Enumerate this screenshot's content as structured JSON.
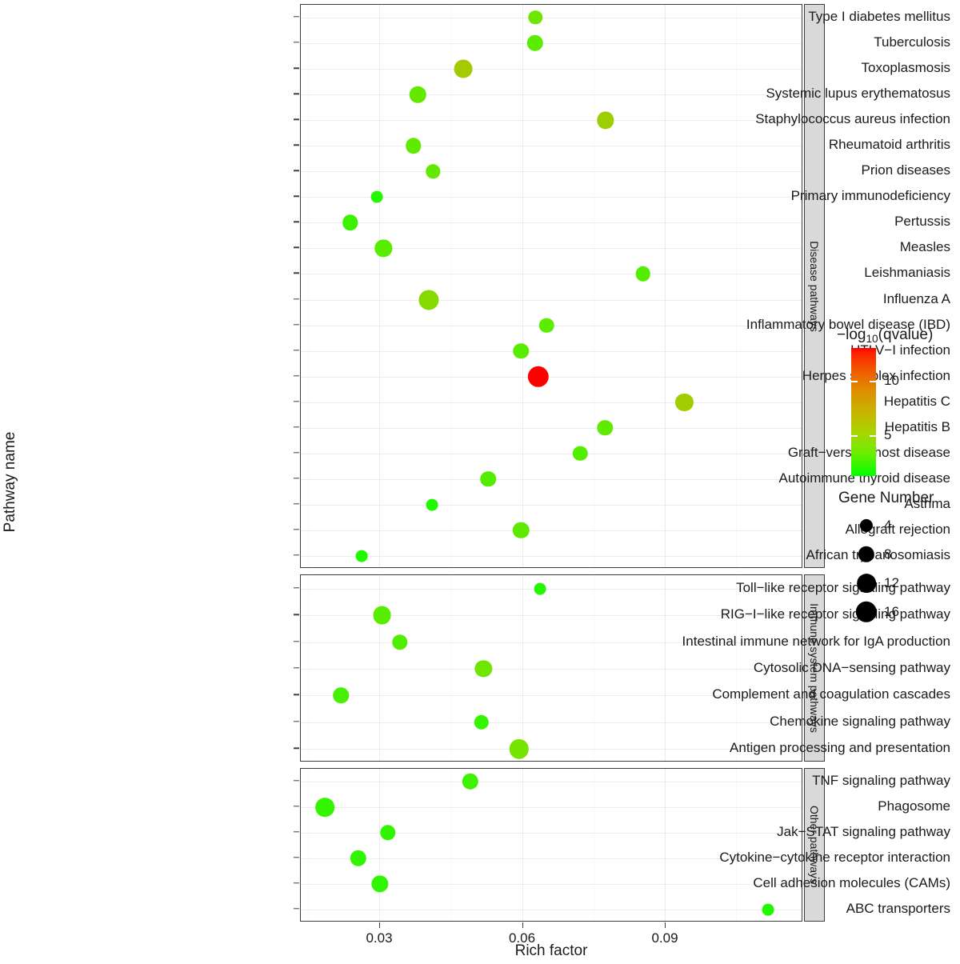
{
  "axes": {
    "y_title": "Pathway name",
    "x_title": "Rich factor",
    "x_ticks": [
      0.03,
      0.06,
      0.09
    ],
    "x_tick_labels": [
      "0.03",
      "0.06",
      "0.09"
    ],
    "x_range": [
      0.0125,
      0.1185
    ]
  },
  "legends": {
    "color": {
      "title_prefix": "−log",
      "title_sub": "10",
      "title_suffix": "(qvalue)",
      "title_full": "−log10(qvalue)",
      "ticks": [
        5,
        10
      ],
      "tick_labels": [
        "5",
        "10"
      ],
      "range": [
        1.3,
        13.0
      ],
      "low_color": "#00ff00",
      "mid_color": "#c8b400",
      "high_color": "#ff0000"
    },
    "size": {
      "title": "Gene Number",
      "breaks": [
        4,
        8,
        12,
        16
      ],
      "break_labels": [
        "4",
        "8",
        "12",
        "16"
      ]
    }
  },
  "chart_data": {
    "type": "scatter",
    "title": "",
    "xlabel": "Rich factor",
    "ylabel": "Pathway name",
    "xlim": [
      0.0125,
      0.1185
    ],
    "grid": true,
    "legend_position": "right",
    "facets": [
      {
        "label": "Disease pathways",
        "points": [
          {
            "name": "Type I diabetes mellitus",
            "rich": 0.0628,
            "gene_number": 5,
            "qvalue_log10": 3.0,
            "color": "#6ee600"
          },
          {
            "name": "Tuberculosis",
            "rich": 0.0627,
            "gene_number": 8,
            "qvalue_log10": 3.2,
            "color": "#5bed00"
          },
          {
            "name": "Toxoplasmosis",
            "rich": 0.0476,
            "gene_number": 11,
            "qvalue_log10": 5.2,
            "color": "#a4ca00"
          },
          {
            "name": "Systemic lupus erythematosus",
            "rich": 0.0381,
            "gene_number": 8,
            "qvalue_log10": 3.1,
            "color": "#63e900"
          },
          {
            "name": "Staphylococcus aureus infection",
            "rich": 0.0775,
            "gene_number": 9,
            "qvalue_log10": 4.8,
            "color": "#9dce00"
          },
          {
            "name": "Rheumatoid arthritis",
            "rich": 0.0372,
            "gene_number": 7,
            "qvalue_log10": 3.0,
            "color": "#5fea00"
          },
          {
            "name": "Prion diseases",
            "rich": 0.0413,
            "gene_number": 5,
            "qvalue_log10": 3.0,
            "color": "#62e900"
          },
          {
            "name": "Primary immunodeficiency",
            "rich": 0.0295,
            "gene_number": 3,
            "qvalue_log10": 2.2,
            "color": "#22f800"
          },
          {
            "name": "Pertussis",
            "rich": 0.0239,
            "gene_number": 7,
            "qvalue_log10": 2.6,
            "color": "#3bf300"
          },
          {
            "name": "Measles",
            "rich": 0.0309,
            "gene_number": 9,
            "qvalue_log10": 2.9,
            "color": "#57ec00"
          },
          {
            "name": "Leishmaniasis",
            "rich": 0.0854,
            "gene_number": 6,
            "qvalue_log10": 2.8,
            "color": "#52ed00"
          },
          {
            "name": "Influenza A",
            "rich": 0.0404,
            "gene_number": 14,
            "qvalue_log10": 4.0,
            "color": "#86da00"
          },
          {
            "name": "Inflammatory bowel disease (IBD)",
            "rich": 0.0652,
            "gene_number": 6,
            "qvalue_log10": 2.9,
            "color": "#5bec00"
          },
          {
            "name": "HTLV−I infection",
            "rich": 0.0598,
            "gene_number": 7,
            "qvalue_log10": 2.9,
            "color": "#58ec00"
          },
          {
            "name": "Herpes simplex infection",
            "rich": 0.0634,
            "gene_number": 16,
            "qvalue_log10": 13.0,
            "color": "#ff0000"
          },
          {
            "name": "Hepatitis C",
            "rich": 0.0941,
            "gene_number": 10,
            "qvalue_log10": 5.0,
            "color": "#a0cd00"
          },
          {
            "name": "Hepatitis B",
            "rich": 0.0774,
            "gene_number": 7,
            "qvalue_log10": 3.0,
            "color": "#5fea00"
          },
          {
            "name": "Graft−versus−host disease",
            "rich": 0.0722,
            "gene_number": 6,
            "qvalue_log10": 2.8,
            "color": "#51ee00"
          },
          {
            "name": "Autoimmune thyroid disease",
            "rich": 0.0529,
            "gene_number": 7,
            "qvalue_log10": 2.8,
            "color": "#52ed00"
          },
          {
            "name": "Asthma",
            "rich": 0.0411,
            "gene_number": 3,
            "qvalue_log10": 2.1,
            "color": "#1ef900"
          },
          {
            "name": "Allograft rejection",
            "rich": 0.0598,
            "gene_number": 8,
            "qvalue_log10": 3.0,
            "color": "#5eea00"
          },
          {
            "name": "African trypanosomiasis",
            "rich": 0.0263,
            "gene_number": 3,
            "qvalue_log10": 2.1,
            "color": "#20f800"
          }
        ]
      },
      {
        "label": "Immune system pathways",
        "points": [
          {
            "name": "Toll−like receptor signaling pathway",
            "rich": 0.0638,
            "gene_number": 3,
            "qvalue_log10": 2.2,
            "color": "#25f700"
          },
          {
            "name": "RIG−I−like receptor signaling pathway",
            "rich": 0.0306,
            "gene_number": 11,
            "qvalue_log10": 2.9,
            "color": "#57ec00"
          },
          {
            "name": "Intestinal immune network for IgA production",
            "rich": 0.0343,
            "gene_number": 7,
            "qvalue_log10": 2.8,
            "color": "#4fee00"
          },
          {
            "name": "Cytosolic DNA−sensing pathway",
            "rich": 0.0519,
            "gene_number": 9,
            "qvalue_log10": 3.3,
            "color": "#6fe600"
          },
          {
            "name": "Complement and coagulation cascades",
            "rich": 0.022,
            "gene_number": 7,
            "qvalue_log10": 2.7,
            "color": "#48ef00"
          },
          {
            "name": "Chemokine signaling pathway",
            "rich": 0.0515,
            "gene_number": 6,
            "qvalue_log10": 2.5,
            "color": "#33f500"
          },
          {
            "name": "Antigen processing and presentation",
            "rich": 0.0594,
            "gene_number": 13,
            "qvalue_log10": 3.4,
            "color": "#77e300"
          }
        ]
      },
      {
        "label": "Other pathways",
        "points": [
          {
            "name": "TNF signaling pathway",
            "rich": 0.0491,
            "gene_number": 8,
            "qvalue_log10": 2.6,
            "color": "#3ef200"
          },
          {
            "name": "Phagosome",
            "rich": 0.0186,
            "gene_number": 12,
            "qvalue_log10": 2.5,
            "color": "#33f500"
          },
          {
            "name": "Jak−STAT signaling pathway",
            "rich": 0.0318,
            "gene_number": 7,
            "qvalue_log10": 2.5,
            "color": "#31f500"
          },
          {
            "name": "Cytokine−cytokine receptor interaction",
            "rich": 0.0256,
            "gene_number": 8,
            "qvalue_log10": 2.5,
            "color": "#31f500"
          },
          {
            "name": "Cell adhesion molecules (CAMs)",
            "rich": 0.0302,
            "gene_number": 9,
            "qvalue_log10": 2.5,
            "color": "#30f600"
          },
          {
            "name": "ABC transporters",
            "rich": 0.1117,
            "gene_number": 3,
            "qvalue_log10": 2.1,
            "color": "#20f800"
          }
        ]
      }
    ]
  }
}
